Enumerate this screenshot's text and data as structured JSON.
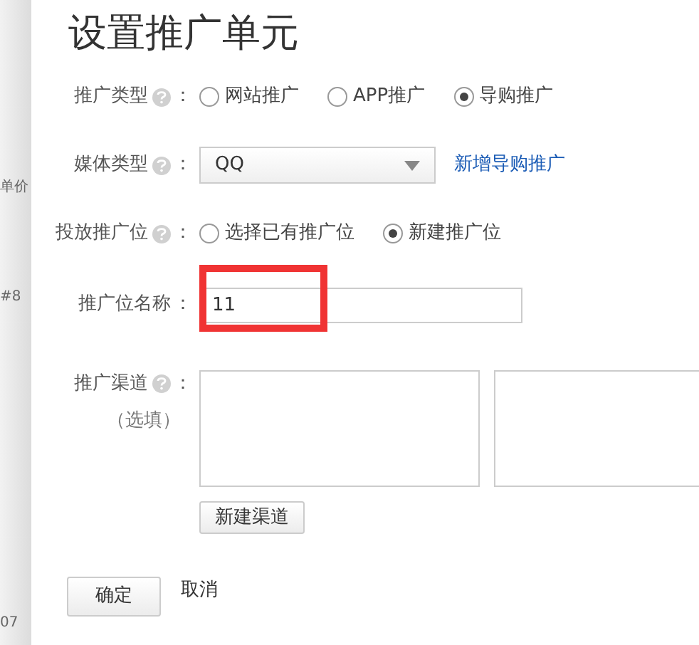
{
  "title": "设置推广单元",
  "form": [
    {
      "kind": "radio",
      "label": "推广类型",
      "help": true,
      "colon": "：",
      "options": [
        {
          "label": "网站推广",
          "selected": false
        },
        {
          "label": "APP推广",
          "selected": false
        },
        {
          "label": "导购推广",
          "selected": true
        }
      ]
    },
    {
      "kind": "select",
      "label": "媒体类型",
      "help": true,
      "colon": "：",
      "value": "QQ",
      "link": "新增导购推广"
    },
    {
      "kind": "radio",
      "label": "投放推广位",
      "help": true,
      "colon": "：",
      "options": [
        {
          "label": "选择已有推广位",
          "selected": false
        },
        {
          "label": "新建推广位",
          "selected": true
        }
      ]
    },
    {
      "kind": "text",
      "label": "推广位名称",
      "colon": "：",
      "value": "11",
      "highlighted": true
    },
    {
      "kind": "textareas",
      "label": "推广渠道",
      "help": true,
      "colon": "：",
      "note": "（选填）",
      "button": "新建渠道"
    }
  ],
  "actions": {
    "confirm": "确定",
    "cancel": "取消"
  },
  "background_fragments": [
    "单价",
    "#8",
    "07"
  ]
}
